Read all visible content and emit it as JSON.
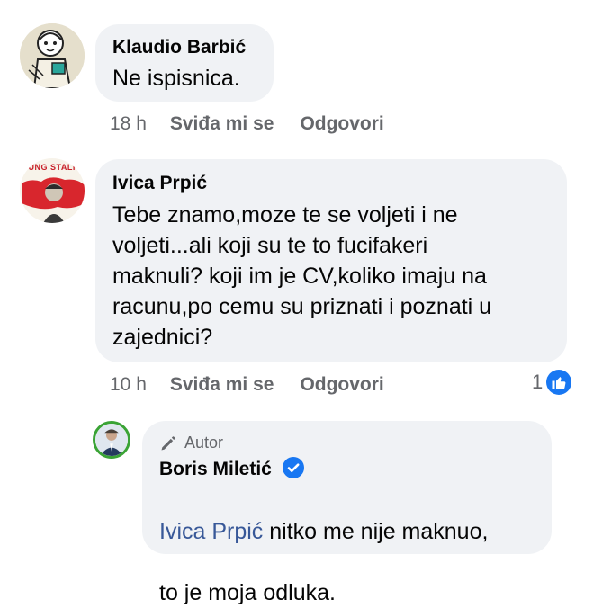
{
  "comments": [
    {
      "author": "Klaudio Barbić",
      "text": "Ne ispisnica.",
      "time": "18 h",
      "like_label": "Sviđa mi se",
      "reply_label": "Odgovori"
    },
    {
      "author": "Ivica Prpić",
      "avatar_caption": "OUNG STALI",
      "text": "Tebe znamo,moze te se voljeti i ne\nvoljeti...ali koji su te to fucifakeri\nmaknuli? koji im je CV,koliko imaju na\nracunu,po cemu su priznati i poznati u\nzajednici?",
      "time": "10 h",
      "like_label": "Sviđa mi se",
      "reply_label": "Odgovori",
      "reaction_count": "1",
      "reaction_icon": "thumbs-up-icon",
      "reaction_color": "#1877f2"
    }
  ],
  "reply": {
    "badge": "Autor",
    "badge_icon": "pencil-icon",
    "author": "Boris Miletić",
    "verified_icon": "verified-badge-icon",
    "mention": "Ivica Prpić",
    "text_line1": " nitko me nije maknuo,",
    "text_line2": "to je moja odluka."
  },
  "colors": {
    "bubble": "#f0f2f5",
    "secondary_text": "#65676b",
    "link": "#385898",
    "accent": "#1877f2"
  }
}
